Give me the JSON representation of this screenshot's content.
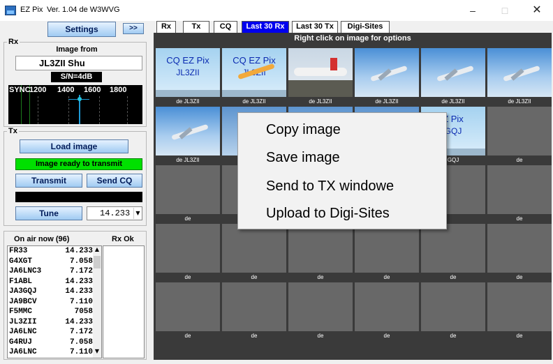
{
  "window": {
    "app_name": "EZ Pix",
    "version": "Ver. 1.04 de W3WVG",
    "min_glyph": "–",
    "max_glyph": "□",
    "close_glyph": "✕"
  },
  "toolbar": {
    "settings_label": "Settings",
    "expand_label": ">>"
  },
  "rx": {
    "group_label": "Rx",
    "image_from_label": "Image from",
    "callsign": "JL3ZII Shu",
    "snr": "S/N=4dB",
    "spectrum_labels": [
      "SYNC",
      "1200",
      "1400",
      "1600",
      "1800"
    ]
  },
  "tx": {
    "group_label": "Tx",
    "load_image_label": "Load image",
    "status": "Image ready to transmit",
    "transmit_label": "Transmit",
    "send_cq_label": "Send CQ",
    "tune_label": "Tune",
    "frequency": "14.233",
    "dropdown_glyph": "▼"
  },
  "on_air": {
    "title": "On air now (96)",
    "rx_ok_title": "Rx Ok",
    "scroll_up_glyph": "▲",
    "scroll_down_glyph": "▼",
    "stations": [
      {
        "call": "FR33",
        "freq": "14.233"
      },
      {
        "call": "G4XGT",
        "freq": "7.058"
      },
      {
        "call": "JA6LNC3",
        "freq": "7.172"
      },
      {
        "call": "F1ABL",
        "freq": "14.233"
      },
      {
        "call": "JA3GQJ",
        "freq": "14.233"
      },
      {
        "call": "JA9BCV",
        "freq": "7.110"
      },
      {
        "call": "F5MMC",
        "freq": "7058"
      },
      {
        "call": "JL3ZII",
        "freq": "14.233"
      },
      {
        "call": "JA6LNC",
        "freq": "7.172"
      },
      {
        "call": "G4RUJ",
        "freq": "7.058"
      },
      {
        "call": "JA6LNC",
        "freq": "7.110"
      }
    ]
  },
  "tabs": [
    {
      "label": "Rx",
      "active": false
    },
    {
      "label": "Tx",
      "active": false
    },
    {
      "label": "CQ",
      "active": false
    },
    {
      "label": "Last 30 Rx",
      "active": true
    },
    {
      "label": "Last 30 Tx",
      "active": false
    },
    {
      "label": "Digi-Sites",
      "active": false
    }
  ],
  "gallery": {
    "header": "Right click on image for options",
    "cells": [
      {
        "caption": "de JL3ZII",
        "image": "cq-ez-pix",
        "cq_text": "CQ EZ Pix",
        "cq_call": "JL3ZII"
      },
      {
        "caption": "de JL3ZII",
        "image": "cq-ez-pix-plane",
        "cq_text": "CQ EZ Pix",
        "cq_call": "JL3ZII"
      },
      {
        "caption": "de JL3ZII",
        "image": "airliner-on-ground"
      },
      {
        "caption": "de JL3ZII",
        "image": "airliner-in-sky"
      },
      {
        "caption": "de JL3ZII",
        "image": "airliner-in-sky"
      },
      {
        "caption": "de JL3ZII",
        "image": "airliner-in-sky"
      },
      {
        "caption": "de JL3ZII",
        "image": "airliner-in-sky"
      },
      {
        "caption": "",
        "image": "partial"
      },
      {
        "caption": "",
        "image": "partial"
      },
      {
        "caption": "",
        "image": "partial"
      },
      {
        "caption": "GQJ",
        "image": "cq-ez-pix-partial",
        "cq_text": "Z Pix",
        "cq_call": "GQJ"
      },
      {
        "caption": "de",
        "image": "empty"
      },
      {
        "caption": "de",
        "image": "empty"
      },
      {
        "caption": "",
        "image": "empty"
      },
      {
        "caption": "",
        "image": "empty"
      },
      {
        "caption": "",
        "image": "empty"
      },
      {
        "caption": "",
        "image": "empty"
      },
      {
        "caption": "de",
        "image": "empty"
      },
      {
        "caption": "de",
        "image": "empty"
      },
      {
        "caption": "de",
        "image": "empty"
      },
      {
        "caption": "de",
        "image": "empty"
      },
      {
        "caption": "de",
        "image": "empty"
      },
      {
        "caption": "de",
        "image": "empty"
      },
      {
        "caption": "de",
        "image": "empty"
      },
      {
        "caption": "de",
        "image": "empty"
      },
      {
        "caption": "de",
        "image": "empty"
      },
      {
        "caption": "de",
        "image": "empty"
      },
      {
        "caption": "de",
        "image": "empty"
      },
      {
        "caption": "de",
        "image": "empty"
      },
      {
        "caption": "de",
        "image": "empty"
      }
    ]
  },
  "context_menu": {
    "items": [
      "Copy image",
      "Save image",
      "Send to TX windowe",
      "Upload to Digi-Sites"
    ]
  }
}
